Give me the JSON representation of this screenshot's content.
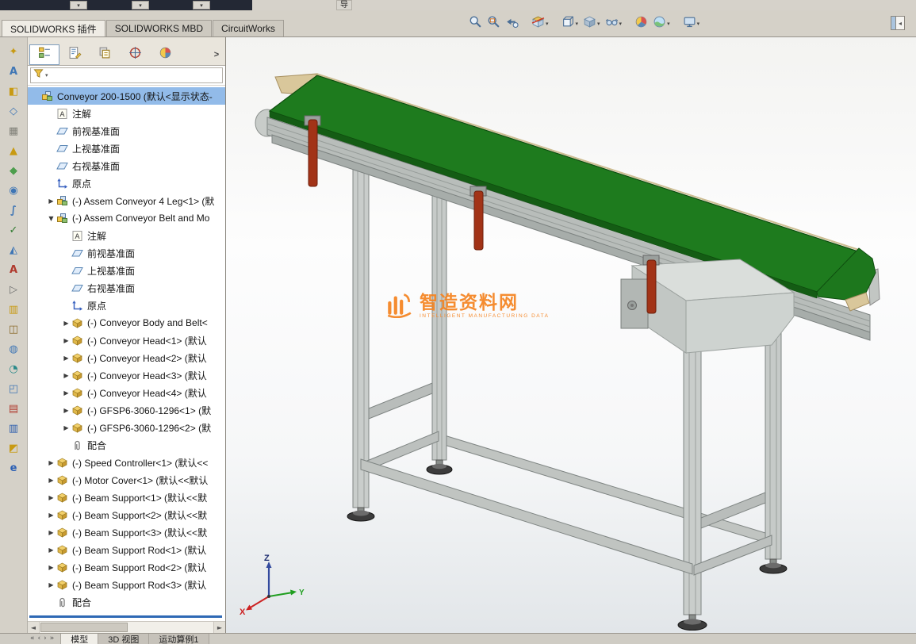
{
  "titlebar": {
    "overflow_text": "导",
    "dropdown_count": 3
  },
  "ribbon": {
    "tabs": [
      {
        "label": "SOLIDWORKS 插件",
        "active": true
      },
      {
        "label": "SOLIDWORKS MBD",
        "active": false
      },
      {
        "label": "CircuitWorks",
        "active": false
      }
    ],
    "view_toolbar": [
      {
        "name": "zoom-to-fit",
        "caret": false,
        "gap": false
      },
      {
        "name": "zoom-to-area",
        "caret": false,
        "gap": false
      },
      {
        "name": "previous-view",
        "caret": false,
        "gap": false
      },
      {
        "name": "section-view",
        "caret": true,
        "gap": true
      },
      {
        "name": "view-orientation",
        "caret": true,
        "gap": true
      },
      {
        "name": "display-style",
        "caret": true,
        "gap": false
      },
      {
        "name": "hide-show-items",
        "caret": true,
        "gap": false
      },
      {
        "name": "edit-appearance",
        "caret": false,
        "gap": true
      },
      {
        "name": "apply-scene",
        "caret": true,
        "gap": false
      },
      {
        "name": "view-settings",
        "caret": true,
        "gap": true
      }
    ]
  },
  "left_toolbar": {
    "items": [
      {
        "name": "left-tool-1",
        "glyph": "✦",
        "color": "#c89a12"
      },
      {
        "name": "left-tool-2",
        "glyph": "A",
        "color": "#3f76b5"
      },
      {
        "name": "left-tool-3",
        "glyph": "◧",
        "color": "#c89a12"
      },
      {
        "name": "left-tool-4",
        "glyph": "◇",
        "color": "#3f76b5"
      },
      {
        "name": "left-tool-5",
        "glyph": "▦",
        "color": "#808078"
      },
      {
        "name": "left-tool-6",
        "glyph": "▲",
        "color": "#c89a12"
      },
      {
        "name": "left-tool-7",
        "glyph": "◆",
        "color": "#4d9e4d"
      },
      {
        "name": "left-tool-8",
        "glyph": "◉",
        "color": "#3f76b5"
      },
      {
        "name": "left-tool-9",
        "glyph": "∫",
        "color": "#3f76b5"
      },
      {
        "name": "left-tool-10",
        "glyph": "✓",
        "color": "#2f7a2f"
      },
      {
        "name": "left-tool-11",
        "glyph": "◭",
        "color": "#3f76b5"
      },
      {
        "name": "left-tool-12",
        "glyph": "A",
        "color": "#b03a2e"
      },
      {
        "name": "left-tool-13",
        "glyph": "▷",
        "color": "#707070"
      },
      {
        "name": "left-tool-14",
        "glyph": "▥",
        "color": "#c89a12"
      },
      {
        "name": "left-tool-15",
        "glyph": "◫",
        "color": "#8a6a2a"
      },
      {
        "name": "left-tool-16",
        "glyph": "◍",
        "color": "#3f76b5"
      },
      {
        "name": "left-tool-17",
        "glyph": "◔",
        "color": "#2a8a8a"
      },
      {
        "name": "left-tool-18",
        "glyph": "◰",
        "color": "#3f76b5"
      },
      {
        "name": "left-tool-19",
        "glyph": "▤",
        "color": "#b03a2e"
      },
      {
        "name": "left-tool-20",
        "glyph": "▥",
        "color": "#2f5fae"
      },
      {
        "name": "left-tool-21",
        "glyph": "◩",
        "color": "#c89a12"
      },
      {
        "name": "left-tool-22",
        "glyph": "e",
        "color": "#2b5fb4"
      }
    ]
  },
  "feature_panel": {
    "tabs": [
      "featuremanager",
      "propertymanager",
      "configurationmanager",
      "dimxpertmanager",
      "displaymanager"
    ],
    "active_tab": 0,
    "overflow_chevron": ">",
    "items": [
      {
        "label": "Conveyor 200-1500 (默认<显示状态-",
        "level": 0,
        "icon": "assembly",
        "arrow": "none",
        "selected": true
      },
      {
        "label": "注解",
        "level": 1,
        "icon": "annotations",
        "arrow": "none"
      },
      {
        "label": "前视基准面",
        "level": 1,
        "icon": "plane",
        "arrow": "none"
      },
      {
        "label": "上视基准面",
        "level": 1,
        "icon": "plane",
        "arrow": "none"
      },
      {
        "label": "右视基准面",
        "level": 1,
        "icon": "plane",
        "arrow": "none"
      },
      {
        "label": "原点",
        "level": 1,
        "icon": "origin",
        "arrow": "none"
      },
      {
        "label": "(-) Assem Conveyor 4 Leg<1> (默",
        "level": 1,
        "icon": "assembly",
        "arrow": "right"
      },
      {
        "label": "(-) Assem Conveyor Belt and Mo",
        "level": 1,
        "icon": "assembly",
        "arrow": "down"
      },
      {
        "label": "注解",
        "level": 2,
        "icon": "annotations",
        "arrow": "none"
      },
      {
        "label": "前视基准面",
        "level": 2,
        "icon": "plane",
        "arrow": "none"
      },
      {
        "label": "上视基准面",
        "level": 2,
        "icon": "plane",
        "arrow": "none"
      },
      {
        "label": "右视基准面",
        "level": 2,
        "icon": "plane",
        "arrow": "none"
      },
      {
        "label": "原点",
        "level": 2,
        "icon": "origin",
        "arrow": "none"
      },
      {
        "label": "(-) Conveyor Body and Belt<",
        "level": 2,
        "icon": "part",
        "arrow": "right"
      },
      {
        "label": "(-) Conveyor Head<1> (默认",
        "level": 2,
        "icon": "part",
        "arrow": "right"
      },
      {
        "label": "(-) Conveyor Head<2> (默认",
        "level": 2,
        "icon": "part",
        "arrow": "right"
      },
      {
        "label": "(-) Conveyor Head<3> (默认",
        "level": 2,
        "icon": "part",
        "arrow": "right"
      },
      {
        "label": "(-) Conveyor Head<4> (默认",
        "level": 2,
        "icon": "part",
        "arrow": "right"
      },
      {
        "label": "(-) GFSP6-3060-1296<1> (默",
        "level": 2,
        "icon": "part",
        "arrow": "right"
      },
      {
        "label": "(-) GFSP6-3060-1296<2> (默",
        "level": 2,
        "icon": "part",
        "arrow": "right"
      },
      {
        "label": "配合",
        "level": 2,
        "icon": "mates",
        "arrow": "none"
      },
      {
        "label": "(-) Speed Controller<1> (默认<<",
        "level": 1,
        "icon": "part",
        "arrow": "right"
      },
      {
        "label": "(-) Motor Cover<1> (默认<<默认",
        "level": 1,
        "icon": "part",
        "arrow": "right"
      },
      {
        "label": "(-) Beam Support<1> (默认<<默",
        "level": 1,
        "icon": "part",
        "arrow": "right"
      },
      {
        "label": "(-) Beam Support<2> (默认<<默",
        "level": 1,
        "icon": "part",
        "arrow": "right"
      },
      {
        "label": "(-) Beam Support<3> (默认<<默",
        "level": 1,
        "icon": "part",
        "arrow": "right"
      },
      {
        "label": "(-) Beam Support Rod<1> (默认",
        "level": 1,
        "icon": "part",
        "arrow": "right"
      },
      {
        "label": "(-) Beam Support Rod<2> (默认",
        "level": 1,
        "icon": "part",
        "arrow": "right"
      },
      {
        "label": "(-) Beam Support Rod<3> (默认",
        "level": 1,
        "icon": "part",
        "arrow": "right"
      },
      {
        "label": "配合",
        "level": 1,
        "icon": "mates",
        "arrow": "none"
      }
    ]
  },
  "viewport": {
    "watermark": {
      "title": "智造资料网",
      "subtitle": "INTELLIGENT MANUFACTURING DATA",
      "accent_color": "#f5831f"
    },
    "triad": {
      "x": "X",
      "y": "Y",
      "z": "Z"
    },
    "model": {
      "belt_color": "#1e7b1e",
      "frame_color": "#c6cac8",
      "clamp_color": "#a23317"
    }
  },
  "bottom_bar": {
    "nav_glyphs": [
      "«",
      "‹",
      "›",
      "»"
    ],
    "tabs": [
      {
        "label": "模型",
        "active": true
      },
      {
        "label": "3D 视图",
        "active": false
      },
      {
        "label": "运动算例1",
        "active": false
      }
    ]
  }
}
